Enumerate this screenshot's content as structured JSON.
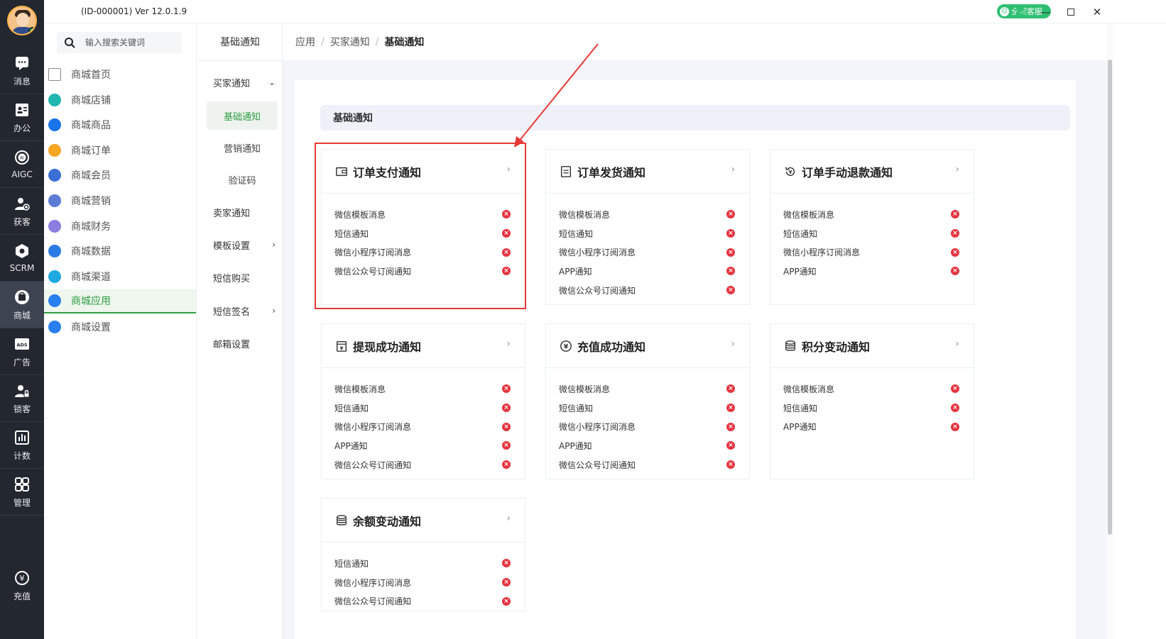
{
  "titlebar": {
    "version": "(ID-000001)  Ver 12.0.1.9",
    "kefu": "全域客服"
  },
  "rail": [
    {
      "label": "消息",
      "icon": "chat-icon"
    },
    {
      "label": "办公",
      "icon": "contact-card-icon"
    },
    {
      "label": "AIGC",
      "icon": "ai-icon"
    },
    {
      "label": "获客",
      "icon": "user-add-icon"
    },
    {
      "label": "SCRM",
      "icon": "scrm-icon"
    },
    {
      "label": "商城",
      "icon": "shop-icon"
    },
    {
      "label": "广告",
      "icon": "ads-icon"
    },
    {
      "label": "锁客",
      "icon": "user-lock-icon"
    },
    {
      "label": "计数",
      "icon": "bar-chart-icon"
    },
    {
      "label": "管理",
      "icon": "grid-icon"
    },
    {
      "label": "充值",
      "icon": "yuan-icon"
    }
  ],
  "search": {
    "placeholder": "输入搜索关键词"
  },
  "menu": [
    {
      "label": "商城首页",
      "icon": "home-icon",
      "color": "#888888"
    },
    {
      "label": "商城店铺",
      "icon": "store-icon",
      "color": "#1fb7b0"
    },
    {
      "label": "商城商品",
      "icon": "bag-icon",
      "color": "#1a73e8"
    },
    {
      "label": "商城订单",
      "icon": "order-icon",
      "color": "#f5a623"
    },
    {
      "label": "商城会员",
      "icon": "members-icon",
      "color": "#3b6fd6"
    },
    {
      "label": "商城营销",
      "icon": "marketing-icon",
      "color": "#5b7bd5"
    },
    {
      "label": "商城财务",
      "icon": "finance-icon",
      "color": "#8a7fe0"
    },
    {
      "label": "商城数据",
      "icon": "data-icon",
      "color": "#2c7be5"
    },
    {
      "label": "商城渠道",
      "icon": "channel-icon",
      "color": "#20a9e0"
    },
    {
      "label": "商城应用",
      "icon": "apps-icon",
      "color": "#2a7ff0"
    },
    {
      "label": "商城设置",
      "icon": "settings-icon",
      "color": "#2a7ff0"
    }
  ],
  "sub": {
    "title": "基础通知",
    "items": [
      {
        "label": "买家通知",
        "chev": "⌄"
      },
      {
        "label": "基础通知"
      },
      {
        "label": "营销通知"
      },
      {
        "label": "验证码"
      },
      {
        "label": "卖家通知"
      },
      {
        "label": "模板设置",
        "chev": "›"
      },
      {
        "label": "短信购买"
      },
      {
        "label": "短信签名",
        "chev": "›"
      },
      {
        "label": "邮箱设置"
      }
    ]
  },
  "breadcrumb": [
    "应用",
    "买家通知",
    "基础通知"
  ],
  "section_title": "基础通知",
  "cards": [
    {
      "title": "订单支付通知",
      "icon": "wallet-icon",
      "items": [
        "微信模板消息",
        "短信通知",
        "微信小程序订阅消息",
        "微信公众号订阅通知"
      ]
    },
    {
      "title": "订单发货通知",
      "icon": "document-icon",
      "items": [
        "微信模板消息",
        "短信通知",
        "微信小程序订阅消息",
        "APP通知",
        "微信公众号订阅通知"
      ]
    },
    {
      "title": "订单手动退款通知",
      "icon": "refund-icon",
      "items": [
        "微信模板消息",
        "短信通知",
        "微信小程序订阅消息",
        "APP通知"
      ]
    },
    {
      "title": "提现成功通知",
      "icon": "withdraw-icon",
      "items": [
        "微信模板消息",
        "短信通知",
        "微信小程序订阅消息",
        "APP通知",
        "微信公众号订阅通知"
      ]
    },
    {
      "title": "充值成功通知",
      "icon": "yuan-circle-icon",
      "items": [
        "微信模板消息",
        "短信通知",
        "微信小程序订阅消息",
        "APP通知",
        "微信公众号订阅通知"
      ]
    },
    {
      "title": "积分变动通知",
      "icon": "coins-icon",
      "items": [
        "微信模板消息",
        "短信通知",
        "APP通知"
      ]
    },
    {
      "title": "余额变动通知",
      "icon": "coins-icon",
      "items": [
        "短信通知",
        "微信小程序订阅消息",
        "微信公众号订阅通知"
      ]
    }
  ],
  "colors": {
    "accent": "#2f9e44",
    "error": "#e5343f",
    "highlight": "#e53935",
    "rail": "#23272f"
  }
}
